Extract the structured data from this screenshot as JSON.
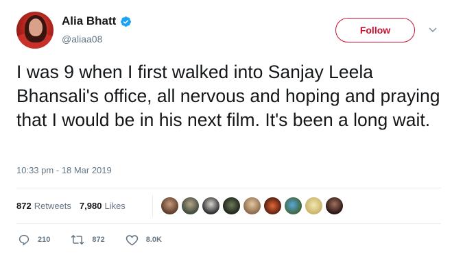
{
  "user": {
    "display_name": "Alia Bhatt",
    "handle": "@aliaa08",
    "verified": true,
    "avatar_icon": "profile-photo"
  },
  "header": {
    "follow_label": "Follow",
    "menu_icon": "chevron-down-icon"
  },
  "tweet": {
    "text": "I was 9 when I first walked into Sanjay Leela Bhansali's office, all nervous and hoping and praying that I would be in his next film. It's been a long wait.",
    "timestamp": "10:33 pm - 18 Mar 2019"
  },
  "stats": {
    "retweets_count": "872",
    "retweets_label": "Retweets",
    "likes_count": "7,980",
    "likes_label": "Likes",
    "liker_avatar_count": 9
  },
  "actions": {
    "reply_count": "210",
    "retweet_count": "872",
    "like_count": "8.0K"
  },
  "colors": {
    "accent": "#c8102e",
    "text": "#14171a",
    "muted": "#657786",
    "divider": "#e6ecf0",
    "verified": "#1da1f2"
  }
}
